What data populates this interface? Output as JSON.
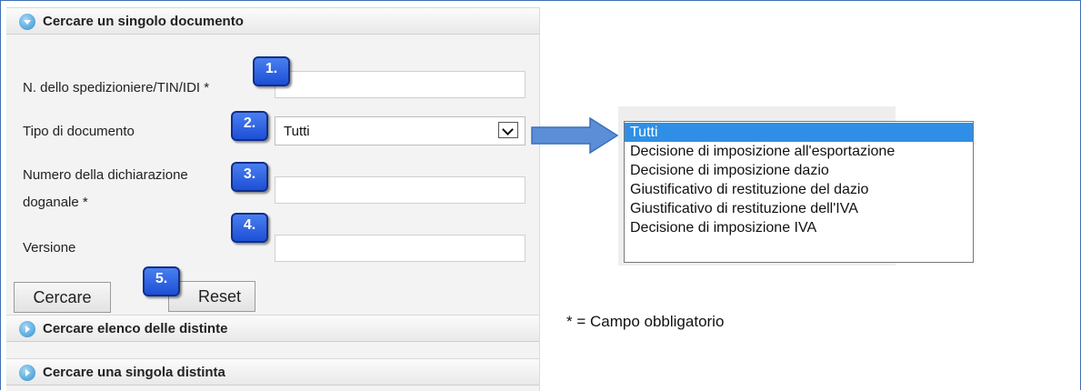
{
  "accordion": {
    "single_document": {
      "title": "Cercare un singolo documento"
    },
    "list_statements": {
      "title": "Cercare elenco delle distinte"
    },
    "single_statement": {
      "title": "Cercare una singola distinta"
    }
  },
  "form": {
    "forwarder_label": "N. dello spedizioniere/TIN/IDI *",
    "forwarder_value": "",
    "doc_type_label": "Tipo di documento",
    "doc_type_value": "Tutti",
    "declaration_label_line1": "Numero della dichiarazione",
    "declaration_label_line2": "doganale *",
    "declaration_value": "",
    "version_label": "Versione",
    "version_value": "",
    "search_button": "Cercare",
    "reset_button": "Reset"
  },
  "badges": [
    "1.",
    "2.",
    "3.",
    "4.",
    "5."
  ],
  "doc_type_options": [
    "Tutti",
    "Decisione di imposizione all'esportazione",
    "Decisione di imposizione dazio",
    "Giustificativo di restituzione del dazio",
    "Giustificativo di restituzione dell'IVA",
    "Decisione di imposizione IVA"
  ],
  "selected_option_index": 0,
  "required_note": "* = Campo obbligatorio",
  "colors": {
    "accent_blue": "#2f8fe6",
    "badge_blue": "#1d4fd6",
    "arrow_blue": "#5b8ed6"
  },
  "icons": {
    "section_open": "chevron-down-circle-icon",
    "section_closed": "chevron-right-circle-icon",
    "select_arrow": "chevron-down-icon",
    "pointer_arrow": "arrow-right-icon"
  }
}
